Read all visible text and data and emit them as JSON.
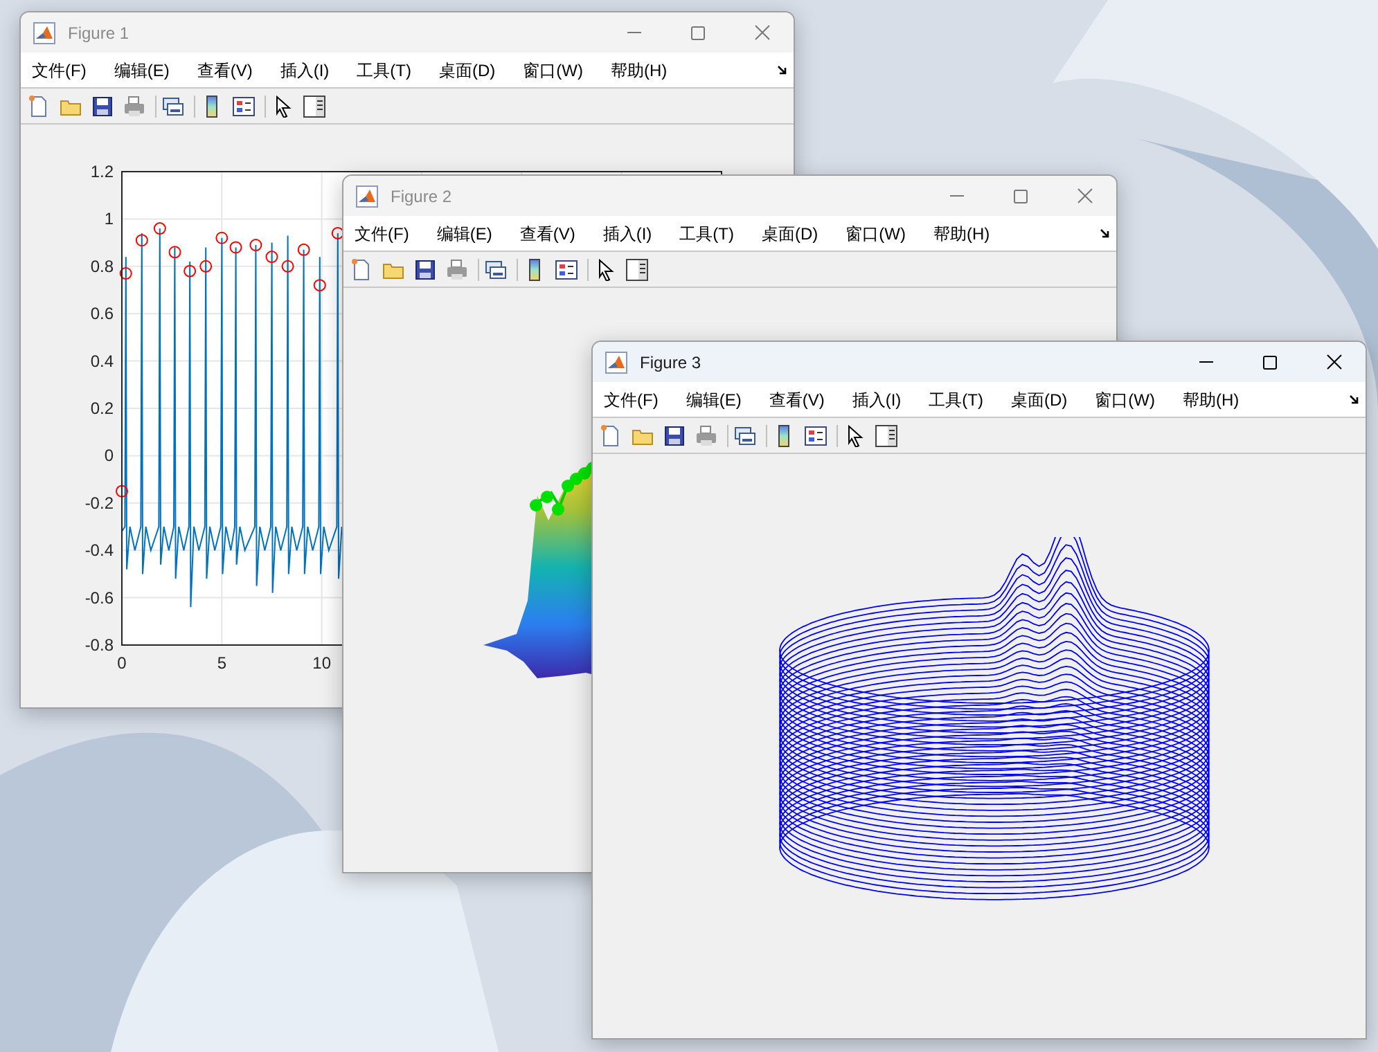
{
  "windows": [
    {
      "title": "Figure 1",
      "active": false,
      "menu": [
        "文件(F)",
        "编辑(E)",
        "查看(V)",
        "插入(I)",
        "工具(T)",
        "桌面(D)",
        "窗口(W)",
        "帮助(H)"
      ],
      "content": {
        "kind": "line_chart",
        "chart_data": {
          "type": "line",
          "grid": true,
          "xlim": [
            0,
            30
          ],
          "ylim": [
            -0.8,
            1.2
          ],
          "xticks": [
            0,
            5,
            10
          ],
          "yticks": [
            -0.8,
            -0.6,
            -0.4,
            -0.2,
            0,
            0.2,
            0.4,
            0.6,
            0.8,
            1,
            1.2
          ],
          "series": [
            {
              "type": "line",
              "color": "#0072bd",
              "x": [
                0,
                0.15,
                0.2,
                0.24,
                0.4,
                0.65,
                0.95,
                1.0,
                1.04,
                1.2,
                1.45,
                1.85,
                1.9,
                1.94,
                2.1,
                2.35,
                2.6,
                2.65,
                2.69,
                2.85,
                3.1,
                3.35,
                3.4,
                3.44,
                3.6,
                3.85,
                4.15,
                4.2,
                4.24,
                4.4,
                4.65,
                4.95,
                5.0,
                5.04,
                5.2,
                5.45,
                5.65,
                5.7,
                5.74,
                5.9,
                6.15,
                6.65,
                6.7,
                6.74,
                6.9,
                7.15,
                7.45,
                7.5,
                7.54,
                7.7,
                7.95,
                8.25,
                8.3,
                8.34,
                8.5,
                8.75,
                9.05,
                9.1,
                9.14,
                9.3,
                9.55,
                9.85,
                9.9,
                9.94,
                10.1,
                10.35,
                10.75,
                10.8,
                10.84,
                11.0
              ],
              "values": [
                -0.32,
                -0.3,
                0.84,
                -0.48,
                -0.3,
                -0.4,
                -0.3,
                0.94,
                -0.5,
                -0.3,
                -0.4,
                -0.3,
                0.96,
                -0.46,
                -0.3,
                -0.4,
                -0.3,
                0.88,
                -0.52,
                -0.3,
                -0.4,
                -0.3,
                0.82,
                -0.64,
                -0.3,
                -0.4,
                -0.3,
                0.88,
                -0.52,
                -0.3,
                -0.4,
                -0.3,
                0.92,
                -0.5,
                -0.3,
                -0.4,
                -0.3,
                0.88,
                -0.46,
                -0.3,
                -0.4,
                -0.3,
                0.89,
                -0.55,
                -0.3,
                -0.4,
                -0.3,
                0.9,
                -0.58,
                -0.3,
                -0.4,
                -0.3,
                0.93,
                -0.5,
                -0.3,
                -0.4,
                -0.3,
                0.87,
                -0.5,
                -0.3,
                -0.4,
                -0.3,
                0.84,
                -0.5,
                -0.3,
                -0.4,
                -0.3,
                0.94,
                -0.52,
                -0.3
              ]
            },
            {
              "type": "scatter",
              "color": "#ff0000",
              "x": [
                0,
                0.2,
                1.0,
                1.9,
                2.65,
                3.4,
                4.2,
                5.0,
                5.7,
                6.7,
                7.5,
                8.3,
                9.1,
                9.9,
                10.8
              ],
              "values": [
                -0.15,
                0.77,
                0.91,
                0.96,
                0.86,
                0.78,
                0.8,
                0.92,
                0.88,
                0.89,
                0.84,
                0.8,
                0.87,
                0.72,
                0.94
              ]
            }
          ]
        }
      }
    },
    {
      "title": "Figure 2",
      "active": false,
      "menu": [
        "文件(F)",
        "编辑(E)",
        "查看(V)",
        "插入(I)",
        "工具(T)",
        "桌面(D)",
        "窗口(W)",
        "帮助(H)"
      ],
      "content": {
        "kind": "surface"
      }
    },
    {
      "title": "Figure 3",
      "active": true,
      "menu": [
        "文件(F)",
        "编辑(E)",
        "查看(V)",
        "插入(I)",
        "工具(T)",
        "桌面(D)",
        "窗口(W)",
        "帮助(H)"
      ],
      "content": {
        "kind": "mesh"
      }
    }
  ]
}
